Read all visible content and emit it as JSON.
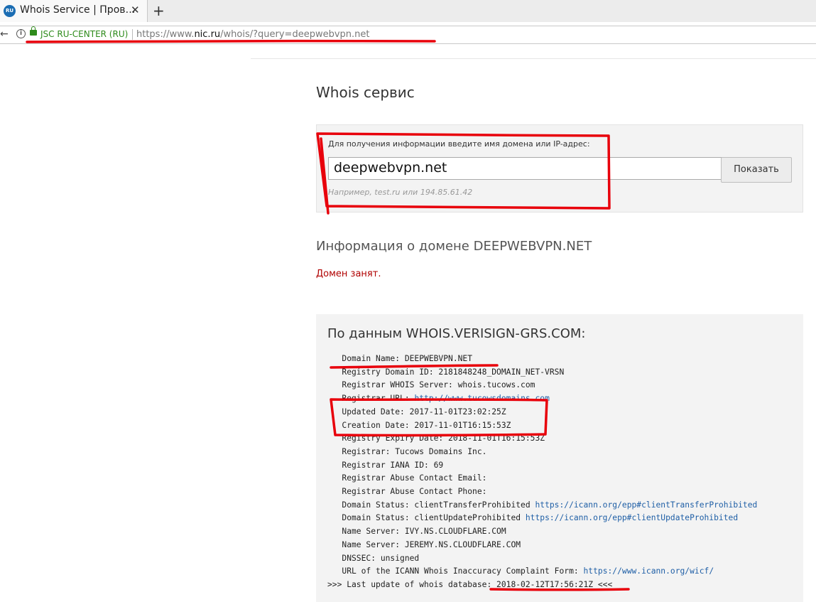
{
  "browser": {
    "tab": {
      "favicon_text": "RU",
      "title": "Whois Service | Пров…",
      "close": "✕"
    },
    "new_tab": "+",
    "urlbar": {
      "company": "JSC RU-CENTER (RU)",
      "url_prefix": "https://www.",
      "url_domain": "nic.ru",
      "url_path": "/whois/?query=deepwebvpn.net"
    }
  },
  "page": {
    "title": "Whois сервис",
    "search": {
      "label": "Для получения информации введите имя домена или IP-адрес:",
      "value": "deepwebvpn.net",
      "button": "Показать",
      "hint": "Например, test.ru или 194.85.61.42"
    },
    "domain_info_heading": "Информация о домене DEEPWEBVPN.NET",
    "status": "Домен занят.",
    "whois": {
      "heading": "По данным WHOIS.VERISIGN-GRS.COM:",
      "lines": [
        {
          "text": "   Domain Name: DEEPWEBVPN.NET",
          "link": ""
        },
        {
          "text": "   Registry Domain ID: 2181848248_DOMAIN_NET-VRSN",
          "link": ""
        },
        {
          "text": "   Registrar WHOIS Server: whois.tucows.com",
          "link": ""
        },
        {
          "text": "   Registrar URL: ",
          "link": "http://www.tucowsdomains.com"
        },
        {
          "text": "   Updated Date: 2017-11-01T23:02:25Z",
          "link": ""
        },
        {
          "text": "   Creation Date: 2017-11-01T16:15:53Z",
          "link": ""
        },
        {
          "text": "   Registry Expiry Date: 2018-11-01T16:15:53Z",
          "link": ""
        },
        {
          "text": "   Registrar: Tucows Domains Inc.",
          "link": ""
        },
        {
          "text": "   Registrar IANA ID: 69",
          "link": ""
        },
        {
          "text": "   Registrar Abuse Contact Email:",
          "link": ""
        },
        {
          "text": "   Registrar Abuse Contact Phone:",
          "link": ""
        },
        {
          "text": "   Domain Status: clientTransferProhibited ",
          "link": "https://icann.org/epp#clientTransferProhibited"
        },
        {
          "text": "   Domain Status: clientUpdateProhibited ",
          "link": "https://icann.org/epp#clientUpdateProhibited"
        },
        {
          "text": "   Name Server: IVY.NS.CLOUDFLARE.COM",
          "link": ""
        },
        {
          "text": "   Name Server: JEREMY.NS.CLOUDFLARE.COM",
          "link": ""
        },
        {
          "text": "   DNSSEC: unsigned",
          "link": ""
        },
        {
          "text": "   URL of the ICANN Whois Inaccuracy Complaint Form: ",
          "link": "https://www.icann.org/wicf/"
        },
        {
          "text": ">>> Last update of whois database: 2018-02-12T17:56:21Z <<<",
          "link": ""
        }
      ]
    }
  },
  "annotation_color": "#e8000b"
}
